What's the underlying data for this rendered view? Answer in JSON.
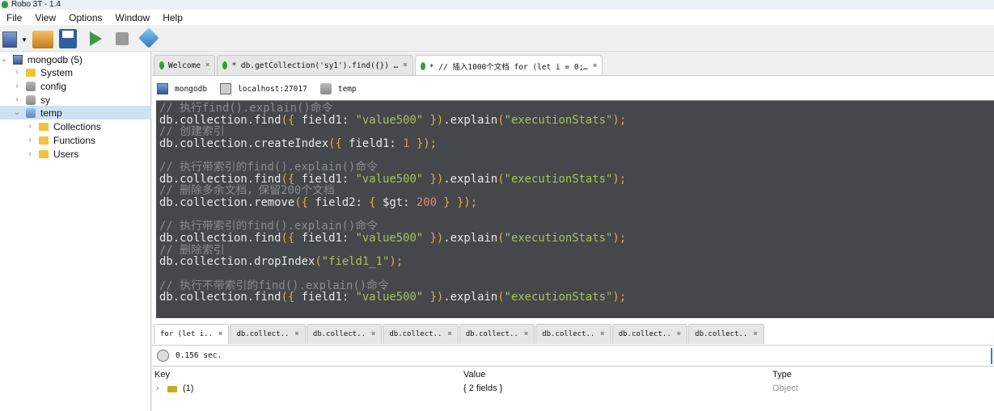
{
  "window": {
    "title": "Robo 3T - 1.4"
  },
  "menu": [
    "File",
    "View",
    "Options",
    "Window",
    "Help"
  ],
  "toolbar": {
    "icons": [
      "connect-icon",
      "open-icon",
      "save-icon",
      "run-icon",
      "stop-icon",
      "rotate-icon"
    ]
  },
  "sidebar": {
    "items": [
      {
        "label": "mongodb (5)",
        "chev": "⌄"
      },
      {
        "label": "System",
        "chev": "›"
      },
      {
        "label": "config",
        "chev": "›"
      },
      {
        "label": "sy",
        "chev": "›"
      },
      {
        "label": "temp",
        "chev": "⌄"
      },
      {
        "label": "Collections",
        "chev": "›"
      },
      {
        "label": "Functions",
        "chev": "›"
      },
      {
        "label": "Users",
        "chev": "›"
      }
    ]
  },
  "tabs": [
    {
      "label": "Welcome",
      "close": "✖"
    },
    {
      "label": "* db.getCollection('sy1').find({}) …",
      "close": "✖"
    },
    {
      "label": "* // 插入1000个文档  for (let i = 0;…",
      "close": "✖"
    }
  ],
  "connection": {
    "server": "mongodb",
    "host": "localhost:27017",
    "database": "temp"
  },
  "editor": {
    "lines": [
      [
        [
          "// 执行find().explain()命令",
          "c"
        ]
      ],
      [
        [
          "db.collection.find",
          ""
        ],
        [
          "({",
          "b"
        ],
        [
          " field1: ",
          ""
        ],
        [
          "\"value500\"",
          "s"
        ],
        [
          " })",
          "b"
        ],
        [
          ".explain",
          ""
        ],
        [
          "(",
          "b"
        ],
        [
          "\"executionStats\"",
          "s"
        ],
        [
          ");",
          "b"
        ]
      ],
      [
        [
          "// 创建索引",
          "c"
        ]
      ],
      [
        [
          "db.collection.createIndex",
          ""
        ],
        [
          "({",
          "b"
        ],
        [
          " field1: ",
          ""
        ],
        [
          "1",
          "n"
        ],
        [
          " });",
          "b"
        ]
      ],
      [],
      [
        [
          "// 执行带索引的find().explain()命令",
          "c"
        ]
      ],
      [
        [
          "db.collection.find",
          ""
        ],
        [
          "({",
          "b"
        ],
        [
          " field1: ",
          ""
        ],
        [
          "\"value500\"",
          "s"
        ],
        [
          " })",
          "b"
        ],
        [
          ".explain",
          ""
        ],
        [
          "(",
          "b"
        ],
        [
          "\"executionStats\"",
          "s"
        ],
        [
          ");",
          "b"
        ]
      ],
      [
        [
          "// 删除多余文档，保留200个文档",
          "c"
        ]
      ],
      [
        [
          "db.collection.remove",
          ""
        ],
        [
          "({",
          "b"
        ],
        [
          " field2: ",
          ""
        ],
        [
          "{",
          "b"
        ],
        [
          " $gt: ",
          ""
        ],
        [
          "200",
          "n"
        ],
        [
          " } });",
          "b"
        ]
      ],
      [],
      [
        [
          "// 执行带索引的find().explain()命令",
          "c"
        ]
      ],
      [
        [
          "db.collection.find",
          ""
        ],
        [
          "({",
          "b"
        ],
        [
          " field1: ",
          ""
        ],
        [
          "\"value500\"",
          "s"
        ],
        [
          " })",
          "b"
        ],
        [
          ".explain",
          ""
        ],
        [
          "(",
          "b"
        ],
        [
          "\"executionStats\"",
          "s"
        ],
        [
          ");",
          "b"
        ]
      ],
      [
        [
          "// 删除索引",
          "c"
        ]
      ],
      [
        [
          "db.collection.dropIndex",
          ""
        ],
        [
          "(",
          "b"
        ],
        [
          "\"field1_1\"",
          "s"
        ],
        [
          ");",
          "b"
        ]
      ],
      [],
      [
        [
          "// 执行不带索引的find().explain()命令",
          "c"
        ]
      ],
      [
        [
          "db.collection.find",
          ""
        ],
        [
          "({",
          "b"
        ],
        [
          " field1: ",
          ""
        ],
        [
          "\"value500\"",
          "s"
        ],
        [
          " })",
          "b"
        ],
        [
          ".explain",
          ""
        ],
        [
          "(",
          "b"
        ],
        [
          "\"executionStats\"",
          "s"
        ],
        [
          ");",
          "b"
        ]
      ]
    ]
  },
  "result_tabs": [
    "for (let i..",
    "db.collect..",
    "db.collect..",
    "db.collect..",
    "db.collect..",
    "db.collect..",
    "db.collect..",
    "db.collect.."
  ],
  "result_close": "✖",
  "status": {
    "time": "0.156 sec."
  },
  "results": {
    "headers": [
      "Key",
      "Value",
      "Type"
    ],
    "row": {
      "expand": "›",
      "key": "(1)",
      "value": "{ 2 fields }",
      "type": "Object"
    }
  }
}
